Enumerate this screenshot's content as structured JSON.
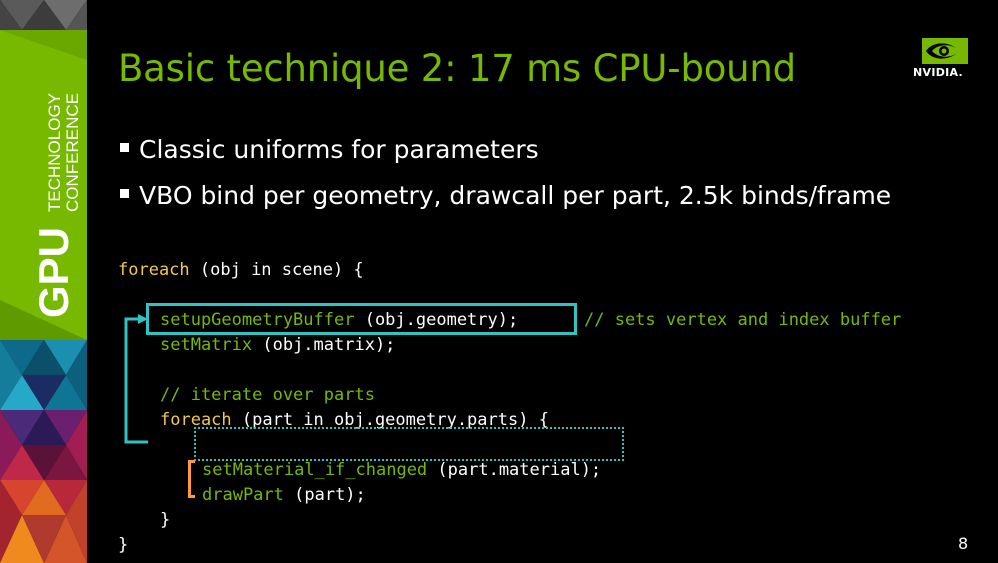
{
  "sidebar": {
    "line1": "GPU",
    "line2": "TECHNOLOGY",
    "line3": "CONFERENCE"
  },
  "slide": {
    "title": "Basic technique 2: 17 ms CPU-bound",
    "bullets": [
      "Classic uniforms for parameters",
      "VBO bind per geometry, drawcall per part, 2.5k binds/frame"
    ],
    "page_number": "8"
  },
  "logo": {
    "text": "NVIDIA."
  },
  "code": {
    "l1_kw": "foreach",
    "l1_rest": " (obj in scene) {",
    "l2_fn": "setupGeometryBuffer",
    "l2_rest": " (obj.geometry);",
    "l2_comment": "// sets vertex and index buffer",
    "l3_fn": "setMatrix",
    "l3_rest": " (obj.matrix);",
    "l4_comment": "// iterate over parts",
    "l5_kw": "foreach",
    "l5_rest": " (part in obj.geometry.parts) {",
    "l6_fn": "setMaterial_if_changed",
    "l6_rest": " (part.material);",
    "l7_fn": "drawPart",
    "l7_rest": " (part);",
    "l8": "}",
    "l9": "}"
  },
  "colors": {
    "accent_green": "#76b900",
    "keyword_yellow": "#f2c94c",
    "highlight_cyan": "#2ec4c4",
    "bracket_orange": "#ff9a3c"
  }
}
